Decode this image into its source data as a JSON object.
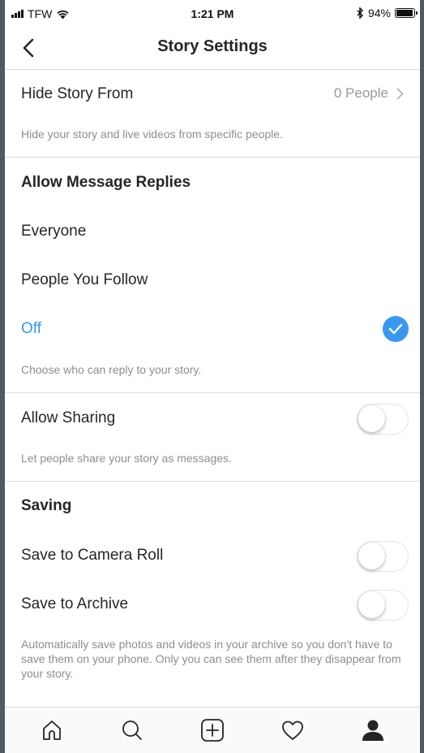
{
  "status_bar": {
    "carrier": "TFW",
    "time": "1:21 PM",
    "battery": "94%",
    "battery_level": 0.94
  },
  "header": {
    "title": "Story Settings",
    "back_icon": "chevron-left-icon"
  },
  "hide_story": {
    "label": "Hide Story From",
    "value": "0 People",
    "note": "Hide your story and live videos from specific people."
  },
  "message_replies": {
    "heading": "Allow Message Replies",
    "options": [
      "Everyone",
      "People You Follow",
      "Off"
    ],
    "selected": "Off",
    "note": "Choose who can reply to your story."
  },
  "sharing": {
    "label": "Allow Sharing",
    "enabled": false,
    "note": "Let people share your story as messages."
  },
  "saving": {
    "heading": "Saving",
    "camera_roll_label": "Save to Camera Roll",
    "camera_roll_enabled": false,
    "archive_label": "Save to Archive",
    "archive_enabled": false,
    "note": "Automatically save photos and videos in your archive so you don't have to save them on your phone. Only you can see them after they disappear from your story."
  },
  "tab_bar": {
    "tabs": [
      "home-icon",
      "search-icon",
      "add-post-icon",
      "activity-heart-icon",
      "profile-icon"
    ],
    "active": "profile-icon"
  },
  "colors": {
    "accent": "#3897f0",
    "text": "#262626",
    "secondary": "#8e8e8e",
    "divider": "#dbdbdb"
  }
}
